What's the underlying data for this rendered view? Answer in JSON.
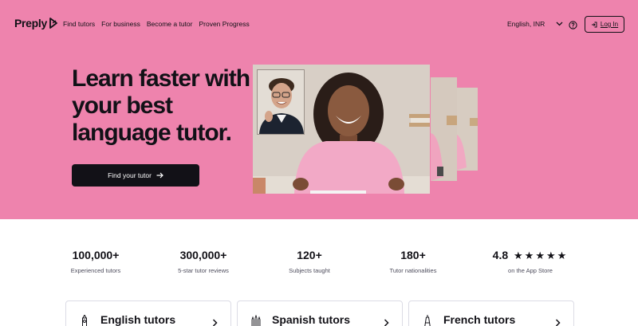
{
  "header": {
    "logo_text": "Preply",
    "nav": [
      "Find tutors",
      "For business",
      "Become a tutor",
      "Proven Progress"
    ],
    "language": "English, INR",
    "login_label": "Log In"
  },
  "hero": {
    "headline": "Learn faster with your best language tutor.",
    "cta_label": "Find your tutor",
    "background_color": "#ee83ad"
  },
  "stats": [
    {
      "value": "100,000+",
      "label": "Experienced tutors"
    },
    {
      "value": "300,000+",
      "label": "5-star tutor reviews"
    },
    {
      "value": "120+",
      "label": "Subjects taught"
    },
    {
      "value": "180+",
      "label": "Tutor nationalities"
    },
    {
      "value": "4.8",
      "stars": "★★★★★",
      "label": "on the App Store"
    }
  ],
  "cards": [
    {
      "title": "English tutors",
      "icon": "big-ben-icon"
    },
    {
      "title": "Spanish tutors",
      "icon": "sagrada-familia-icon"
    },
    {
      "title": "French tutors",
      "icon": "eiffel-tower-icon"
    }
  ]
}
